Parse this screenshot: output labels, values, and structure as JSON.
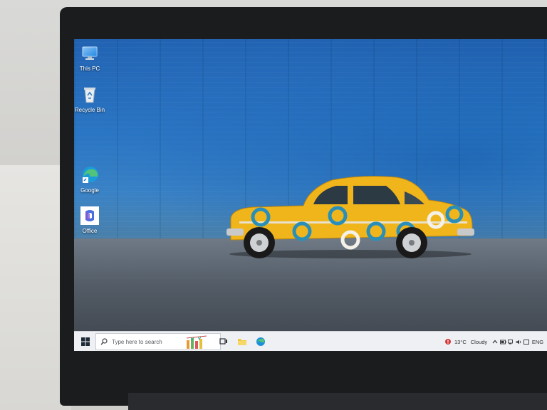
{
  "desktop": {
    "icons": [
      {
        "label": "This PC",
        "icon": "this-pc-icon"
      },
      {
        "label": "Recycle Bin",
        "icon": "recycle-bin-icon"
      },
      {
        "label": "Google",
        "icon": "edge-shortcut-icon"
      },
      {
        "label": "Office",
        "icon": "office-icon"
      }
    ]
  },
  "taskbar": {
    "search": {
      "placeholder": "Type here to search"
    },
    "weather": {
      "temperature": "13°C",
      "condition": "Cloudy"
    },
    "language": "ENG",
    "pinned": [
      "task-view-icon",
      "file-explorer-icon",
      "edge-icon"
    ]
  },
  "colors": {
    "wall_blue": "#2a78c6",
    "car_yellow": "#f1b51c",
    "ring_blue": "#2a8fb8",
    "taskbar_bg": "#eef0f3"
  }
}
